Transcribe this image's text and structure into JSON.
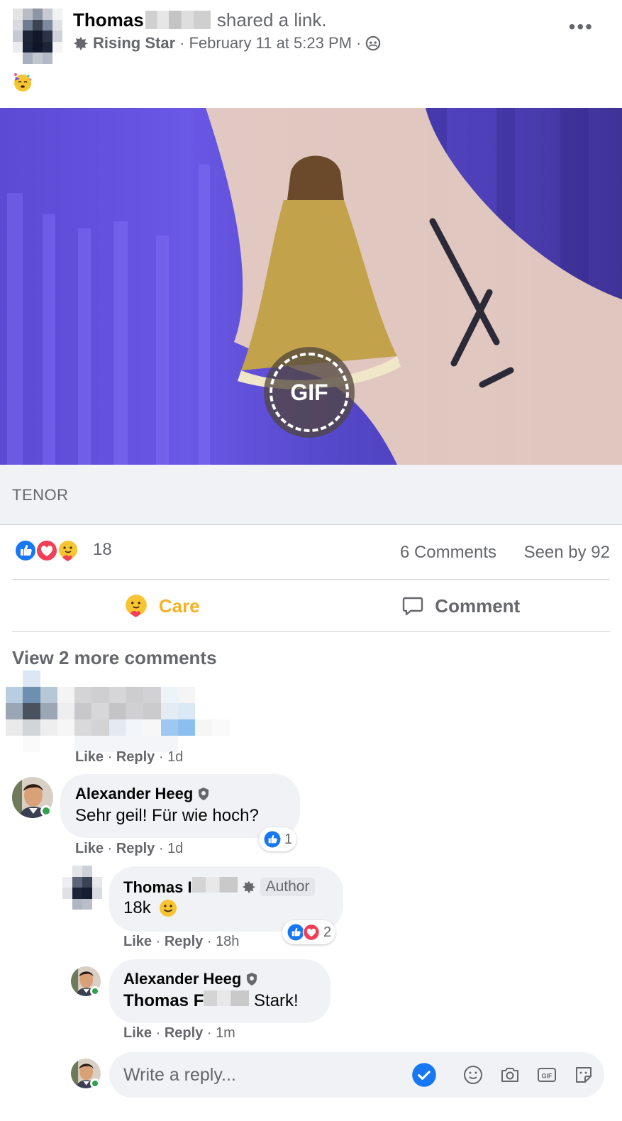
{
  "post": {
    "author_name": "Thomas",
    "shared_text": "shared a link.",
    "badge_label": "Rising Star",
    "timestamp": "February 11 at 5:23 PM",
    "separator": "·",
    "more_icon": "•••",
    "status_emoji_icon": "party-face-icon"
  },
  "media": {
    "gif_label": "GIF",
    "source": "TENOR"
  },
  "stats": {
    "reaction_count": "18",
    "comments": "6 Comments",
    "seen_by": "Seen by 92",
    "reaction_icons": [
      "like-icon",
      "love-icon",
      "care-icon"
    ]
  },
  "actions": {
    "care": "Care",
    "comment": "Comment"
  },
  "view_more": "View 2 more comments",
  "comments": [
    {
      "actions": {
        "like": "Like",
        "reply": "Reply",
        "time": "1d"
      }
    },
    {
      "name": "Alexander Heeg",
      "text": "Sehr geil! Für wie hoch?",
      "reactions": "1",
      "actions": {
        "like": "Like",
        "reply": "Reply",
        "time": "1d"
      }
    },
    {
      "name": "Thomas",
      "name_suffix": "I",
      "badge": "Author",
      "text": "18k",
      "reactions": "2",
      "actions": {
        "like": "Like",
        "reply": "Reply",
        "time": "18h"
      }
    },
    {
      "name": "Alexander Heeg",
      "mention": "Thomas",
      "mention_suffix": "F",
      "text": "Stark!",
      "actions": {
        "like": "Like",
        "reply": "Reply",
        "time": "1m"
      }
    }
  ],
  "reply_box": {
    "placeholder": "Write a reply...",
    "gif_label": "GIF"
  },
  "colors": {
    "care": "#f7b125",
    "like_blue": "#1877f2",
    "love_red": "#f33e58",
    "online": "#31a24c",
    "secondary_text": "#65676b"
  }
}
